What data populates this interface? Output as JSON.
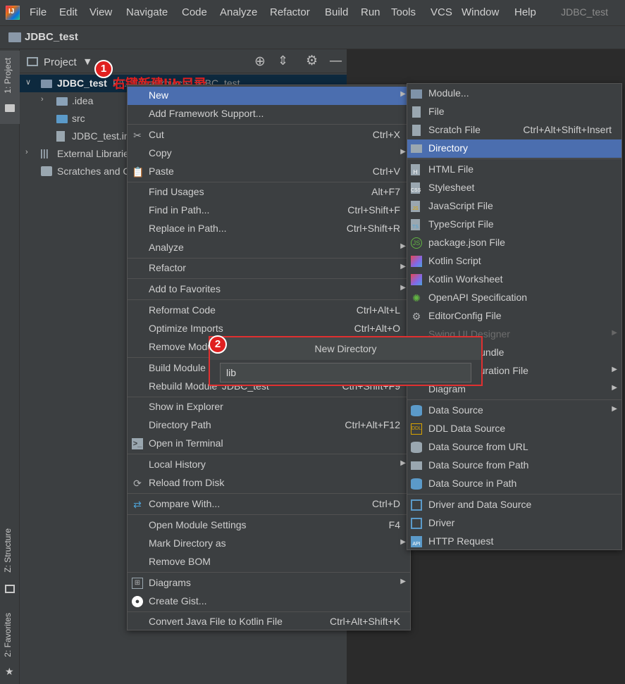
{
  "menubar": {
    "items": [
      "File",
      "Edit",
      "View",
      "Navigate",
      "Code",
      "Analyze",
      "Refactor",
      "Build",
      "Run",
      "Tools",
      "VCS",
      "Window",
      "Help"
    ],
    "title": "JDBC_test"
  },
  "breadcrumb": {
    "label": "JDBC_test"
  },
  "stripe": {
    "project_tab": "1: Project",
    "structure_tab": "Z: Structure",
    "favorites_tab": "2: Favorites"
  },
  "panel": {
    "title": "Project",
    "tree": [
      {
        "label": "JDBC_test",
        "hint": "F:\\...\\IdeaProjects\\JDBC_test"
      },
      {
        "label": ".idea"
      },
      {
        "label": "src"
      },
      {
        "label": "JDBC_test.iml"
      },
      {
        "label": "External Libraries"
      },
      {
        "label": "Scratches and Consoles"
      }
    ]
  },
  "annotation": {
    "step1": "1",
    "step1_text": "右键新建lib目录",
    "step2": "2"
  },
  "context_menu": {
    "items": [
      {
        "label": "New",
        "shortcut": "",
        "submenu": true
      },
      {
        "label": "Add Framework Support...",
        "shortcut": ""
      },
      {
        "label": "Cut",
        "shortcut": "Ctrl+X",
        "icon": "scissors-icon"
      },
      {
        "label": "Copy",
        "shortcut": "",
        "submenu": true
      },
      {
        "label": "Paste",
        "shortcut": "Ctrl+V",
        "icon": "clipboard-icon"
      },
      {
        "label": "Find Usages",
        "shortcut": "Alt+F7"
      },
      {
        "label": "Find in Path...",
        "shortcut": "Ctrl+Shift+F"
      },
      {
        "label": "Replace in Path...",
        "shortcut": "Ctrl+Shift+R"
      },
      {
        "label": "Analyze",
        "shortcut": "",
        "submenu": true
      },
      {
        "label": "Refactor",
        "shortcut": "",
        "submenu": true
      },
      {
        "label": "Add to Favorites",
        "shortcut": "",
        "submenu": true
      },
      {
        "label": "Reformat Code",
        "shortcut": "Ctrl+Alt+L"
      },
      {
        "label": "Optimize Imports",
        "shortcut": "Ctrl+Alt+O"
      },
      {
        "label": "Remove Module",
        "shortcut": ""
      },
      {
        "label": "Build Module 'JDBC_test'",
        "shortcut": ""
      },
      {
        "label": "Rebuild Module 'JDBC_test'",
        "shortcut": "Ctrl+Shift+F9"
      },
      {
        "label": "Show in Explorer",
        "shortcut": ""
      },
      {
        "label": "Directory Path",
        "shortcut": "Ctrl+Alt+F12"
      },
      {
        "label": "Open in Terminal",
        "shortcut": "",
        "icon": "terminal-icon"
      },
      {
        "label": "Local History",
        "shortcut": "",
        "submenu": true
      },
      {
        "label": "Reload from Disk",
        "shortcut": "",
        "icon": "reload-icon"
      },
      {
        "label": "Compare With...",
        "shortcut": "Ctrl+D",
        "icon": "compare-icon"
      },
      {
        "label": "Open Module Settings",
        "shortcut": "F4"
      },
      {
        "label": "Mark Directory as",
        "shortcut": "",
        "submenu": true
      },
      {
        "label": "Remove BOM",
        "shortcut": ""
      },
      {
        "label": "Diagrams",
        "shortcut": "",
        "submenu": true,
        "icon": "diagram-icon"
      },
      {
        "label": "Create Gist...",
        "shortcut": "",
        "icon": "github-icon"
      },
      {
        "label": "Convert Java File to Kotlin File",
        "shortcut": "Ctrl+Alt+Shift+K"
      }
    ]
  },
  "new_submenu": {
    "items": [
      {
        "label": "Module...",
        "shortcut": ""
      },
      {
        "label": "File",
        "shortcut": ""
      },
      {
        "label": "Scratch File",
        "shortcut": "Ctrl+Alt+Shift+Insert"
      },
      {
        "label": "Directory",
        "shortcut": ""
      },
      {
        "label": "HTML File",
        "shortcut": ""
      },
      {
        "label": "Stylesheet",
        "shortcut": ""
      },
      {
        "label": "JavaScript File",
        "shortcut": ""
      },
      {
        "label": "TypeScript File",
        "shortcut": ""
      },
      {
        "label": "package.json File",
        "shortcut": ""
      },
      {
        "label": "Kotlin Script",
        "shortcut": ""
      },
      {
        "label": "Kotlin Worksheet",
        "shortcut": ""
      },
      {
        "label": "OpenAPI Specification",
        "shortcut": ""
      },
      {
        "label": "EditorConfig File",
        "shortcut": ""
      },
      {
        "label": "Swing UI Designer",
        "shortcut": ""
      },
      {
        "label": "Resource Bundle",
        "shortcut": ""
      },
      {
        "label": "XML Configuration File",
        "shortcut": ""
      },
      {
        "label": "Diagram",
        "shortcut": ""
      },
      {
        "label": "Data Source",
        "shortcut": ""
      },
      {
        "label": "DDL Data Source",
        "shortcut": ""
      },
      {
        "label": "Data Source from URL",
        "shortcut": ""
      },
      {
        "label": "Data Source from Path",
        "shortcut": ""
      },
      {
        "label": "Data Source in Path",
        "shortcut": ""
      },
      {
        "label": "Driver and Data Source",
        "shortcut": ""
      },
      {
        "label": "Driver",
        "shortcut": ""
      },
      {
        "label": "HTTP Request",
        "shortcut": ""
      }
    ]
  },
  "dialog": {
    "title": "New Directory",
    "value": "lib"
  },
  "colors": {
    "highlight": "#4b6eaf",
    "annotation": "#e02020",
    "panel": "#3c3f41",
    "editor": "#2b2b2b"
  }
}
